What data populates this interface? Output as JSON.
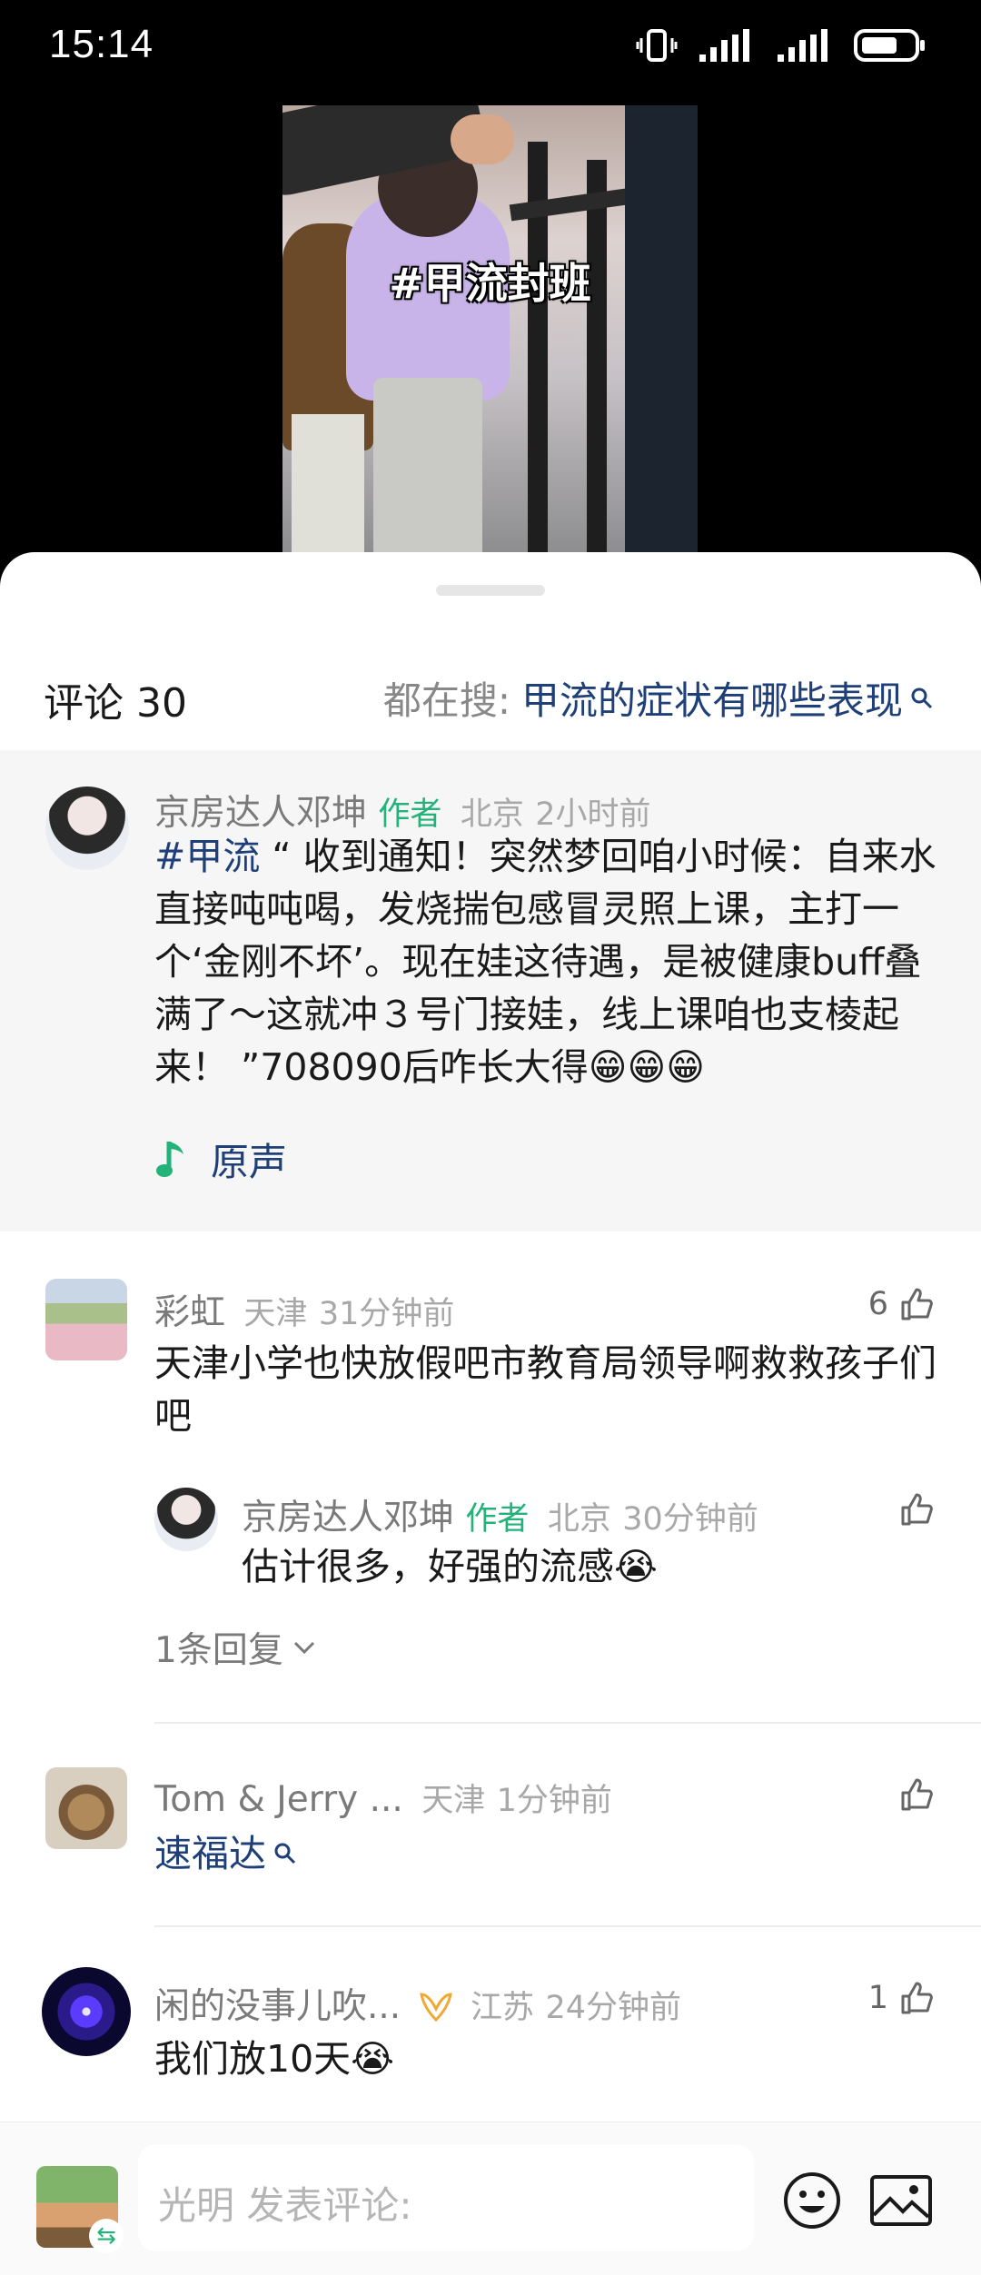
{
  "status": {
    "time": "15:14"
  },
  "video": {
    "caption": "#甲流封班"
  },
  "header": {
    "comment_label": "评论 30",
    "hot_prefix": "都在搜:",
    "hot_query": "甲流的症状有哪些表现"
  },
  "pinned": {
    "username": "京房达人邓坤",
    "author_tag": "作者",
    "location": "北京",
    "time": "2小时前",
    "topic": "#甲流",
    "text": " “ 收到通知！突然梦回咱小时候：自来水直接吨吨喝，发烧揣包感冒灵照上课，主打一个‘金刚不坏’。现在娃这待遇，是被健康buff叠满了～这就冲３号门接娃，线上课咱也支棱起来！ ”708090后咋长大得😁😁😁",
    "original_sound": "原声"
  },
  "comments": [
    {
      "username": "彩虹",
      "location": "天津",
      "time": "31分钟前",
      "likes": "6",
      "text": "天津小学也快放假吧市教育局领导啊救救孩子们吧",
      "reply": {
        "username": "京房达人邓坤",
        "author_tag": "作者",
        "location": "北京",
        "time": "30分钟前",
        "text": "估计很多，好强的流感😭"
      },
      "more_replies": "1条回复"
    },
    {
      "username": "Tom & Jerry ...",
      "location": "天津",
      "time": "1分钟前",
      "text": "速福达"
    },
    {
      "username": "闲的没事儿吹...",
      "location": "江苏",
      "time": "24分钟前",
      "likes": "1",
      "text": "我们放10天😭"
    }
  ],
  "input_bar": {
    "placeholder": "光明 发表评论:"
  },
  "colors": {
    "link_blue": "#1f3f78",
    "author_green": "#22b27a",
    "meta_gray": "#a8a8a8"
  }
}
